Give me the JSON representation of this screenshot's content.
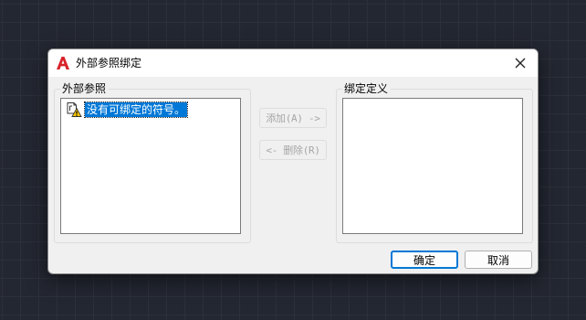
{
  "window": {
    "title": "外部参照绑定",
    "app_icon": "autocad-a-icon",
    "close_icon": "close-icon"
  },
  "xref_group": {
    "label": "外部参照",
    "items": [
      {
        "icon": "xref-warning-icon",
        "label": "没有可绑定的符号。",
        "selected": true
      }
    ]
  },
  "bind_group": {
    "label": "绑定定义",
    "items": []
  },
  "buttons": {
    "add": {
      "label": "添加(A) ->",
      "enabled": false
    },
    "remove": {
      "label": "<- 删除(R)",
      "enabled": false
    },
    "ok": {
      "label": "确定"
    },
    "cancel": {
      "label": "取消"
    }
  },
  "colors": {
    "accent": "#0078d7",
    "brand": "#d8232a",
    "canvas_bg": "#232731",
    "disabled_text": "#a6a6a6"
  }
}
